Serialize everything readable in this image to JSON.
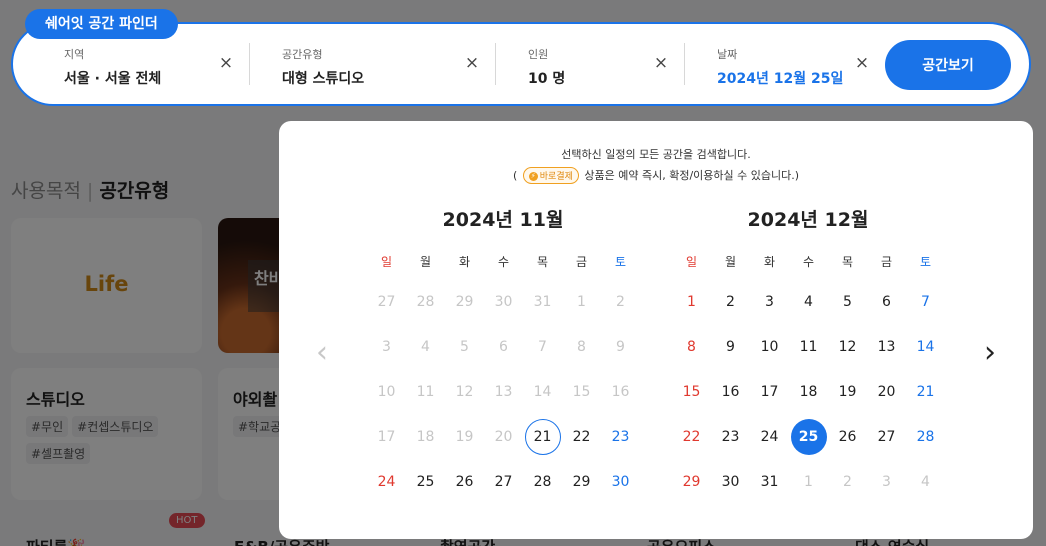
{
  "brand_label": "쉐어잇 공간 파인더",
  "fields": [
    {
      "label": "지역",
      "value": "서울 · 서울 전체",
      "accent": false
    },
    {
      "label": "공간유형",
      "value": "대형 스튜디오",
      "accent": false
    },
    {
      "label": "인원",
      "value": "10 명",
      "accent": false
    },
    {
      "label": "날짜",
      "value": "2024년 12월 25일",
      "accent": true
    }
  ],
  "clear_icon": "×",
  "search_button": "공간보기",
  "calendar": {
    "notice_line1": "선택하신 일정의 모든 공간을 검색합니다.",
    "notice_open": "(",
    "pay_badge": "바로결제",
    "notice_line2": "상품은 예약 즉시, 확정/이용하실 수 있습니다.)",
    "prev_icon": "‹",
    "next_icon": "›",
    "weekdays": [
      "일",
      "월",
      "화",
      "수",
      "목",
      "금",
      "토"
    ],
    "months": [
      {
        "title": "2024년 11월",
        "days": [
          {
            "d": "27",
            "dis": true
          },
          {
            "d": "28",
            "dis": true
          },
          {
            "d": "29",
            "dis": true
          },
          {
            "d": "30",
            "dis": true
          },
          {
            "d": "31",
            "dis": true
          },
          {
            "d": "1",
            "dis": true
          },
          {
            "d": "2",
            "dis": true
          },
          {
            "d": "3",
            "dis": true
          },
          {
            "d": "4",
            "dis": true
          },
          {
            "d": "5",
            "dis": true
          },
          {
            "d": "6",
            "dis": true
          },
          {
            "d": "7",
            "dis": true
          },
          {
            "d": "8",
            "dis": true
          },
          {
            "d": "9",
            "dis": true
          },
          {
            "d": "10",
            "dis": true
          },
          {
            "d": "11",
            "dis": true
          },
          {
            "d": "12",
            "dis": true
          },
          {
            "d": "13",
            "dis": true
          },
          {
            "d": "14",
            "dis": true
          },
          {
            "d": "15",
            "dis": true
          },
          {
            "d": "16",
            "dis": true
          },
          {
            "d": "17",
            "dis": true
          },
          {
            "d": "18",
            "dis": true
          },
          {
            "d": "19",
            "dis": true
          },
          {
            "d": "20",
            "dis": true
          },
          {
            "d": "21",
            "today": true
          },
          {
            "d": "22"
          },
          {
            "d": "23"
          },
          {
            "d": "24"
          },
          {
            "d": "25"
          },
          {
            "d": "26"
          },
          {
            "d": "27"
          },
          {
            "d": "28"
          },
          {
            "d": "29"
          },
          {
            "d": "30"
          }
        ]
      },
      {
        "title": "2024년 12월",
        "days": [
          {
            "d": "1"
          },
          {
            "d": "2"
          },
          {
            "d": "3"
          },
          {
            "d": "4"
          },
          {
            "d": "5"
          },
          {
            "d": "6"
          },
          {
            "d": "7"
          },
          {
            "d": "8"
          },
          {
            "d": "9"
          },
          {
            "d": "10"
          },
          {
            "d": "11"
          },
          {
            "d": "12"
          },
          {
            "d": "13"
          },
          {
            "d": "14"
          },
          {
            "d": "15"
          },
          {
            "d": "16"
          },
          {
            "d": "17"
          },
          {
            "d": "18"
          },
          {
            "d": "19"
          },
          {
            "d": "20"
          },
          {
            "d": "21"
          },
          {
            "d": "22"
          },
          {
            "d": "23"
          },
          {
            "d": "24"
          },
          {
            "d": "25",
            "selected": true
          },
          {
            "d": "26"
          },
          {
            "d": "27"
          },
          {
            "d": "28"
          },
          {
            "d": "29"
          },
          {
            "d": "30"
          },
          {
            "d": "31"
          },
          {
            "d": "1",
            "dis": true
          },
          {
            "d": "2",
            "dis": true
          },
          {
            "d": "3",
            "dis": true
          },
          {
            "d": "4",
            "dis": true
          }
        ]
      }
    ]
  },
  "background": {
    "heading_prefix": "사용목적",
    "heading_sep": "|",
    "heading_active": "공간유형",
    "life_label": "Life",
    "photo_label": "찬바",
    "card_studio": {
      "title": "스튜디오",
      "tags": [
        "#무인",
        "#컨셉스튜디오",
        "#셀프촬영"
      ]
    },
    "card_outdoor": {
      "title": "야외촬",
      "tags": [
        "#학교공"
      ]
    },
    "hot_badge": "HOT",
    "bottom_labels": [
      "파티룸🎉",
      "F&B/공유주방",
      "촬영공간",
      "공유오피스",
      "댄스 연습실"
    ]
  }
}
